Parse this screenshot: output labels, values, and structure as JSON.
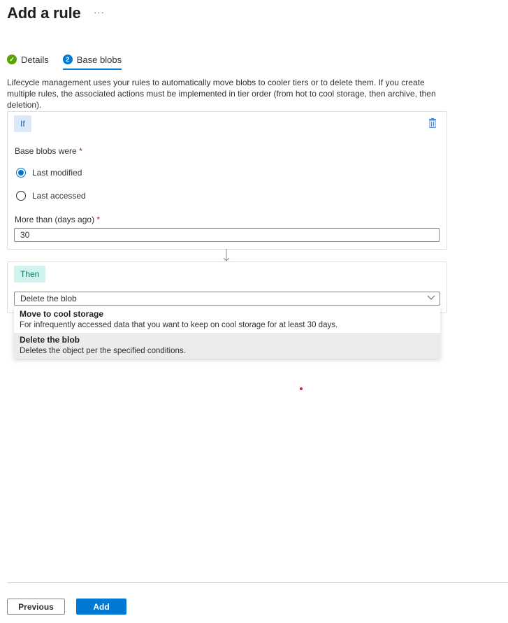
{
  "header": {
    "title": "Add a rule",
    "more_label": "···"
  },
  "steps": [
    {
      "label": "Details",
      "state": "completed",
      "icon": "check-circle-icon"
    },
    {
      "label": "Base blobs",
      "number": "2",
      "state": "active"
    }
  ],
  "description": "Lifecycle management uses your rules to automatically move blobs to cooler tiers or to delete them. If you create multiple rules, the associated actions must be implemented in tier order (from hot to cool storage, then archive, then deletion).",
  "if_block": {
    "tag": "If",
    "base_blobs_label": "Base blobs were",
    "required_mark": "*",
    "options": [
      {
        "label": "Last modified",
        "selected": true
      },
      {
        "label": "Last accessed",
        "selected": false
      }
    ],
    "days_label": "More than (days ago)",
    "days_value": "30"
  },
  "then_block": {
    "tag": "Then",
    "selected_action": "Delete the blob",
    "options": [
      {
        "title": "Move to cool storage",
        "subtitle": "For infrequently accessed data that you want to keep on cool storage for at least 30 days.",
        "selected": false
      },
      {
        "title": "Delete the blob",
        "subtitle": "Deletes the object per the specified conditions.",
        "selected": true
      }
    ]
  },
  "footer": {
    "previous_label": "Previous",
    "add_label": "Add"
  },
  "colors": {
    "accent": "#0078d4",
    "success": "#57a300",
    "if_tag_bg": "#dce8fa",
    "then_tag_bg": "#d0f3ef"
  }
}
